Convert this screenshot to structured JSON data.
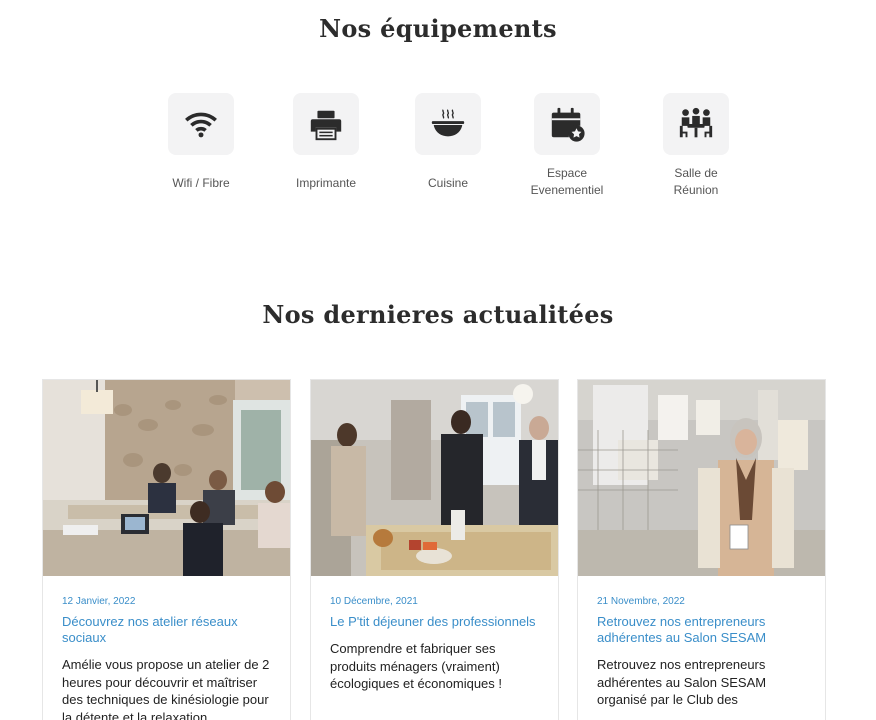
{
  "equipment": {
    "title": "Nos équipements",
    "items": [
      {
        "label": "Wifi / Fibre",
        "icon": "wifi-icon"
      },
      {
        "label": "Imprimante",
        "icon": "printer-icon"
      },
      {
        "label": "Cuisine",
        "icon": "kitchen-bowl-icon"
      },
      {
        "label": "Espace\nEvenementiel",
        "icon": "calendar-star-icon"
      },
      {
        "label": "Salle de\nRéunion",
        "icon": "meeting-room-icon"
      }
    ]
  },
  "news": {
    "title": "Nos dernieres actualitées",
    "cards": [
      {
        "date": "12 Janvier, 2022",
        "title": "Découvrez nos atelier réseaux sociaux",
        "excerpt": "Amélie vous propose un atelier de 2 heures pour découvrir et maîtriser des techniques de kinésiologie pour la détente et la relaxation"
      },
      {
        "date": "10 Décembre, 2021",
        "title": "Le P'tit déjeuner des professionnels",
        "excerpt": "Comprendre et fabriquer ses produits ménagers (vraiment) écologiques et économiques !"
      },
      {
        "date": "21 Novembre, 2022",
        "title": "Retrouvez nos entrepreneurs adhérentes au Salon SESAM",
        "excerpt": "Retrouvez nos entrepreneurs adhérentes au Salon SESAM organisé par le Club des"
      }
    ]
  }
}
